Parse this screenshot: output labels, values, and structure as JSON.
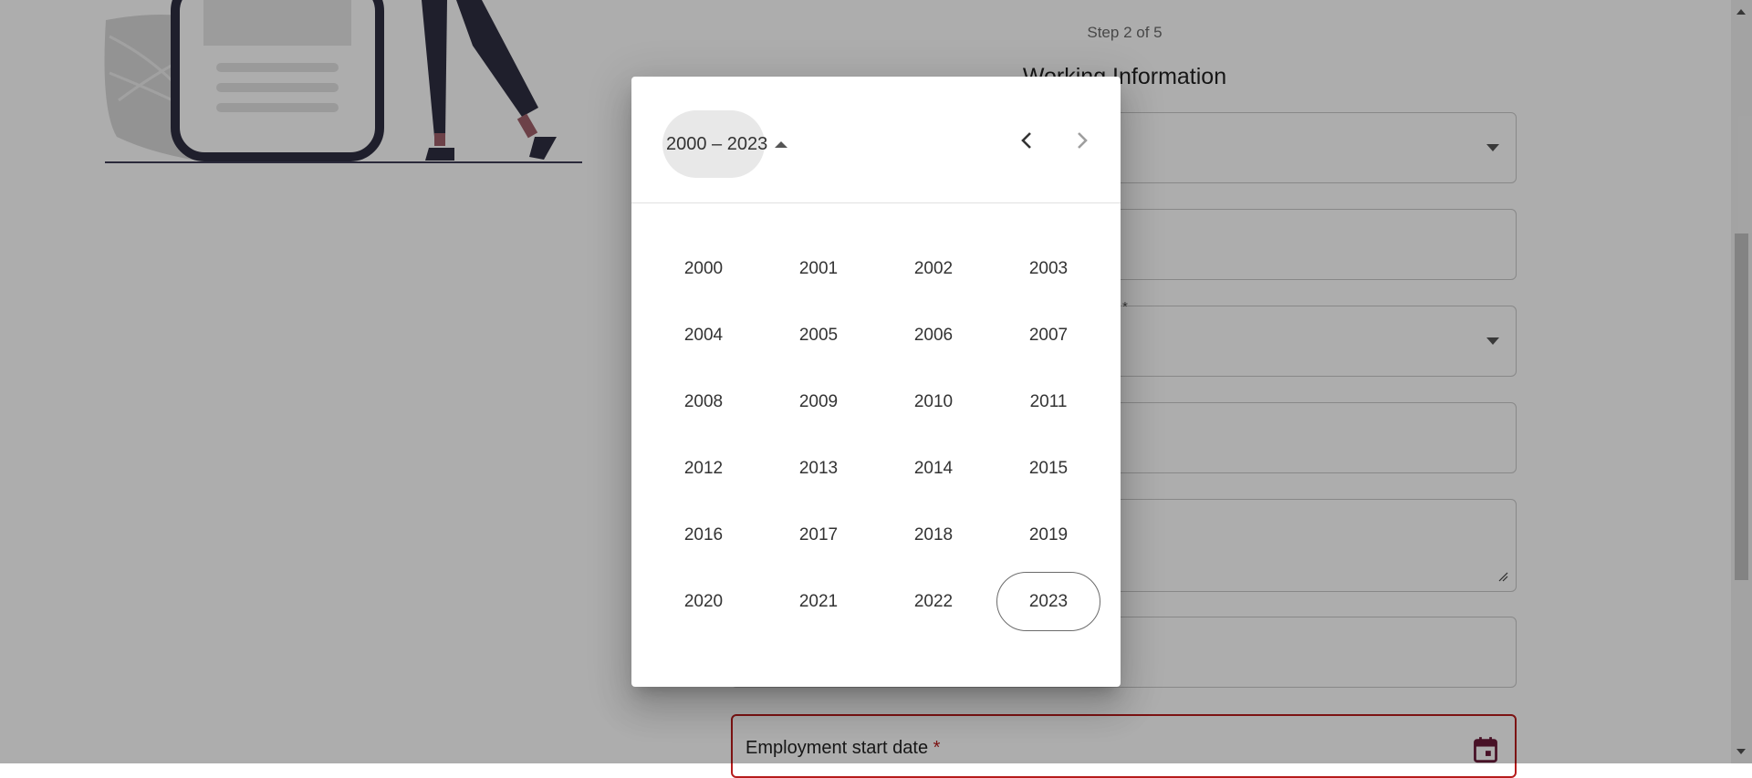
{
  "form": {
    "step_text": "Step 2 of 5",
    "section_title": "Working Information",
    "required_star": "*",
    "employment_start_date_label": "Employment start date",
    "employment_start_date_required": "*"
  },
  "datepicker": {
    "period_label": "2000 – 2023",
    "prev_icon": "chevron-left-icon",
    "next_icon": "chevron-right-icon",
    "years": [
      [
        "2000",
        "2001",
        "2002",
        "2003"
      ],
      [
        "2004",
        "2005",
        "2006",
        "2007"
      ],
      [
        "2008",
        "2009",
        "2010",
        "2011"
      ],
      [
        "2012",
        "2013",
        "2014",
        "2015"
      ],
      [
        "2016",
        "2017",
        "2018",
        "2019"
      ],
      [
        "2020",
        "2021",
        "2022",
        "2023"
      ]
    ],
    "current_year": "2023"
  },
  "colors": {
    "error": "#b71c1c",
    "calendar_icon": "#6a1b3a",
    "illustration_dark": "#2f2e41"
  }
}
